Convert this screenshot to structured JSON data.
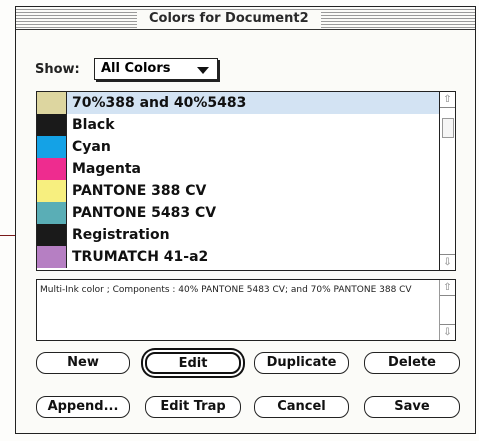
{
  "window": {
    "title": "Colors for Document2"
  },
  "show": {
    "label": "Show:",
    "value": "All Colors"
  },
  "colors": [
    {
      "name": "70%388 and 40%5483",
      "swatch": "#ddd6a0",
      "selected": true
    },
    {
      "name": "Black",
      "swatch": "#1a1a1a",
      "selected": false
    },
    {
      "name": "Cyan",
      "swatch": "#14a2e6",
      "selected": false
    },
    {
      "name": "Magenta",
      "swatch": "#ee2c8f",
      "selected": false
    },
    {
      "name": "PANTONE 388 CV",
      "swatch": "#f7ef7f",
      "selected": false
    },
    {
      "name": "PANTONE 5483 CV",
      "swatch": "#5aaeb6",
      "selected": false
    },
    {
      "name": "Registration",
      "swatch": "#1a1a1a",
      "selected": false
    },
    {
      "name": "TRUMATCH 41-a2",
      "swatch": "#b67fc3",
      "selected": false
    }
  ],
  "description": "Multi-Ink color ; Components : 40% PANTONE 5483 CV; and 70% PANTONE 388 CV",
  "buttons": {
    "new": "New",
    "edit": "Edit",
    "duplicate": "Duplicate",
    "delete": "Delete",
    "append": "Append...",
    "edit_trap": "Edit Trap",
    "cancel": "Cancel",
    "save": "Save"
  },
  "icons": {
    "scroll_up": "up-arrow-icon",
    "scroll_down": "down-arrow-icon",
    "dropdown": "triangle-down-icon"
  }
}
